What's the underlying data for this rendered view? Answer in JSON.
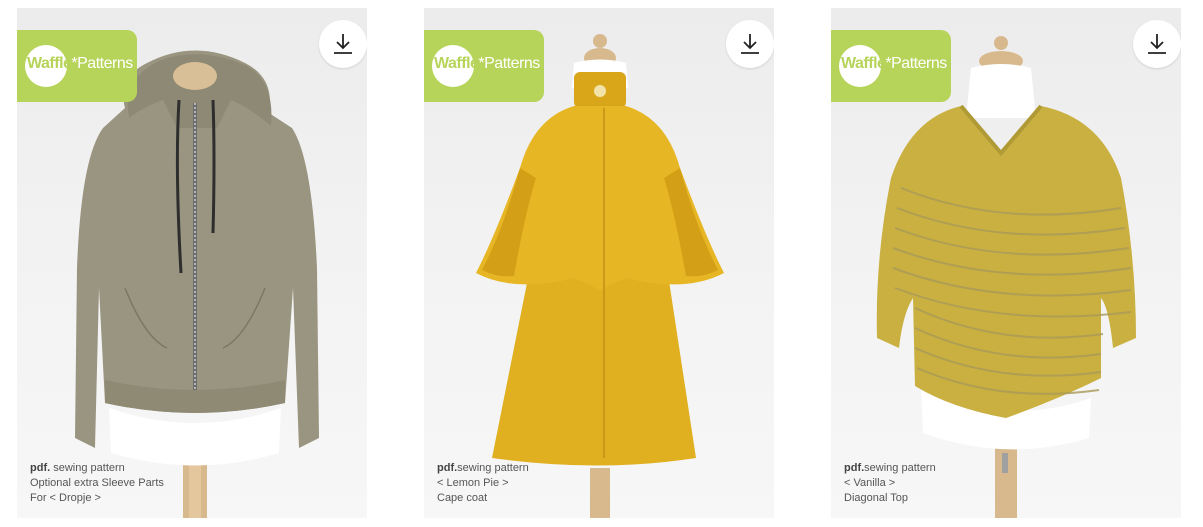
{
  "brand": {
    "name_part1": "Waffle",
    "name_part2": "*Patterns"
  },
  "cards": [
    {
      "caption_pdf": "pdf.",
      "caption_type": " sewing pattern",
      "caption_line2": "Optional extra Sleeve Parts",
      "caption_line3": "For < Dropje >",
      "garment_color": "#9a9580",
      "icon": "download-icon"
    },
    {
      "caption_pdf": "pdf.",
      "caption_type": "sewing pattern",
      "caption_line2": "< Lemon Pie >",
      "caption_line3": "Cape coat",
      "garment_color": "#e0b020",
      "icon": "download-icon"
    },
    {
      "caption_pdf": "pdf.",
      "caption_type": "sewing pattern",
      "caption_line2": "< Vanilla >",
      "caption_line3": "Diagonal Top",
      "garment_color": "#c9b040",
      "icon": "download-icon"
    }
  ],
  "colors": {
    "brand_green": "#b7d45a",
    "card_bg": "#efefef",
    "caption_text": "#555555"
  }
}
